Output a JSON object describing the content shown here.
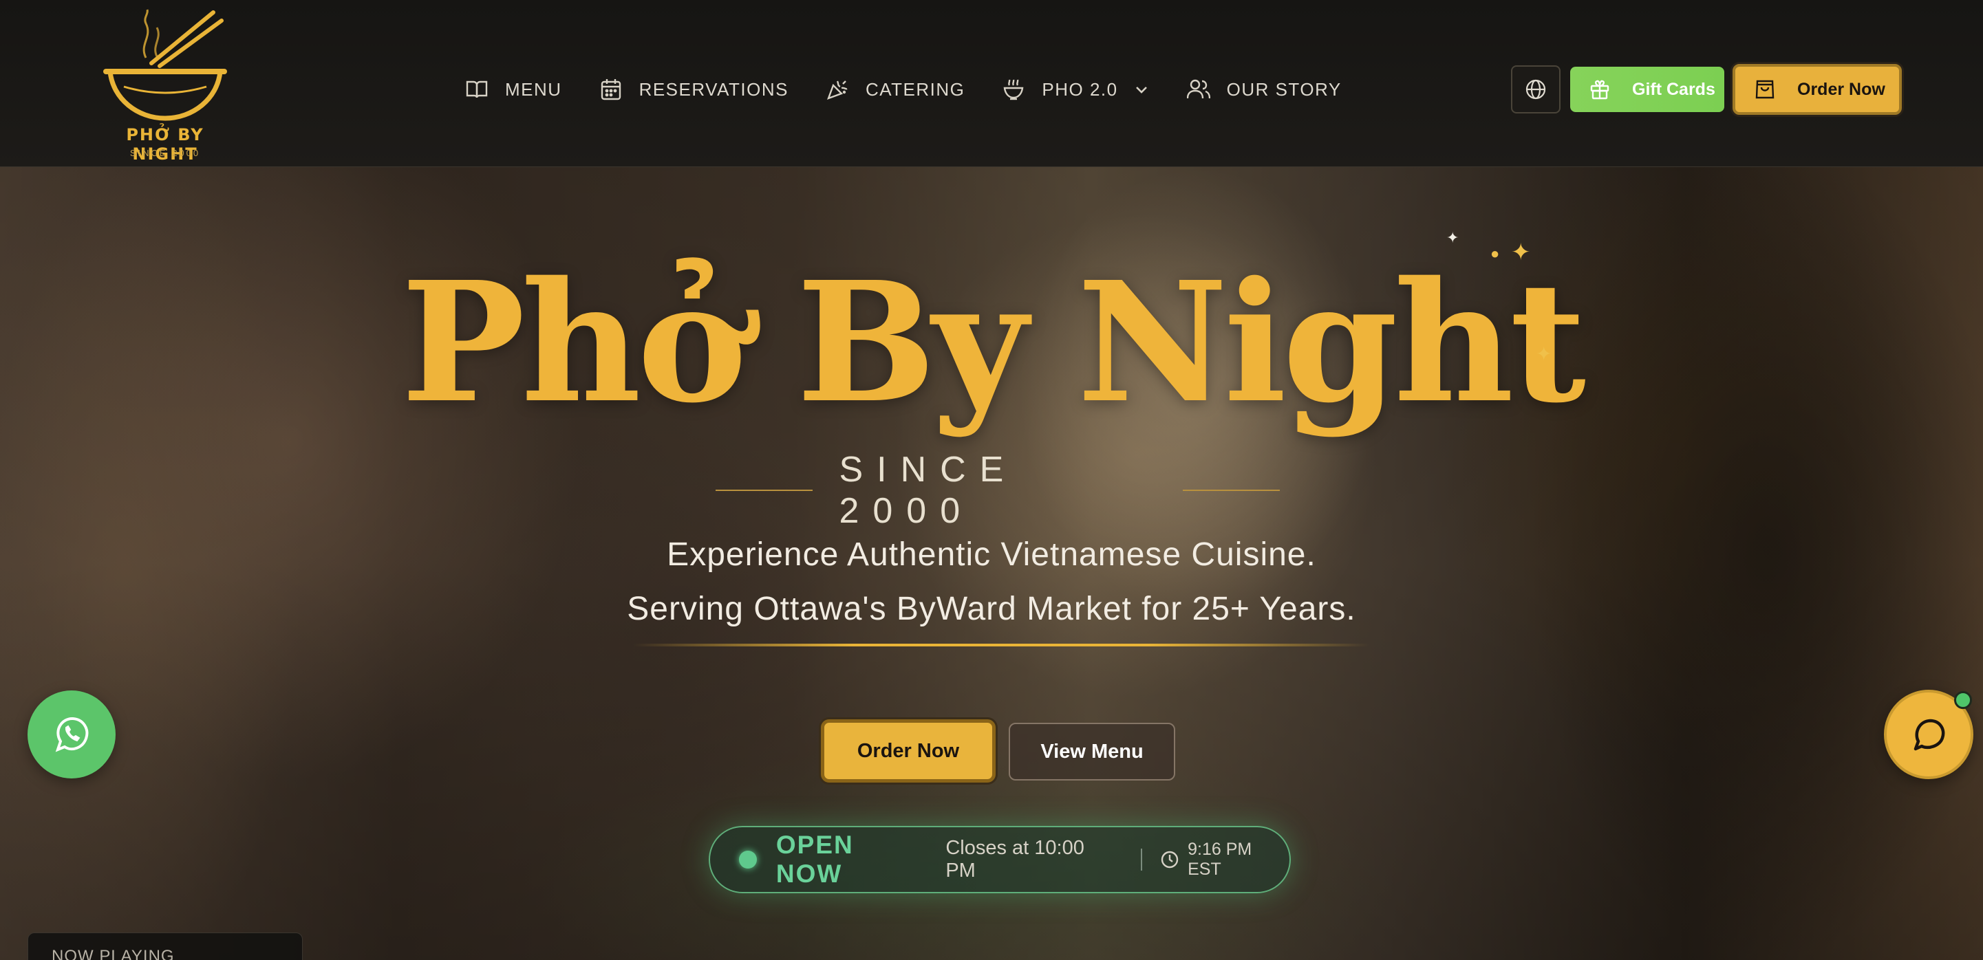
{
  "brand": {
    "name": "PHỞ BY NIGHT",
    "since": "SINCE 2000",
    "accent": "#e9b437"
  },
  "nav": {
    "items": [
      {
        "label": "MENU",
        "icon": "book-icon"
      },
      {
        "label": "RESERVATIONS",
        "icon": "calendar-icon"
      },
      {
        "label": "CATERING",
        "icon": "party-popper-icon"
      },
      {
        "label": "PHO 2.0",
        "icon": "bowl-icon",
        "has_dropdown": true
      },
      {
        "label": "OUR STORY",
        "icon": "users-icon"
      }
    ]
  },
  "header_actions": {
    "language_icon": "globe-icon",
    "gift_cards_label": "Gift Cards",
    "order_now_label": "Order Now"
  },
  "hero": {
    "title": "Phở By Night",
    "since": "SINCE 2000",
    "tagline_line1": "Experience Authentic Vietnamese Cuisine.",
    "tagline_line2": "Serving Ottawa's ByWard Market for 25+ Years.",
    "cta_order": "Order Now",
    "cta_menu": "View Menu"
  },
  "status": {
    "open_label": "OPEN NOW",
    "closes": "Closes at 10:00 PM",
    "current_time": "9:16 PM EST",
    "status_color": "#5fc98d"
  },
  "widgets": {
    "now_playing_label": "NOW PLAYING",
    "whatsapp_icon": "whatsapp-icon",
    "chat_icon": "chat-bubble-icon"
  }
}
